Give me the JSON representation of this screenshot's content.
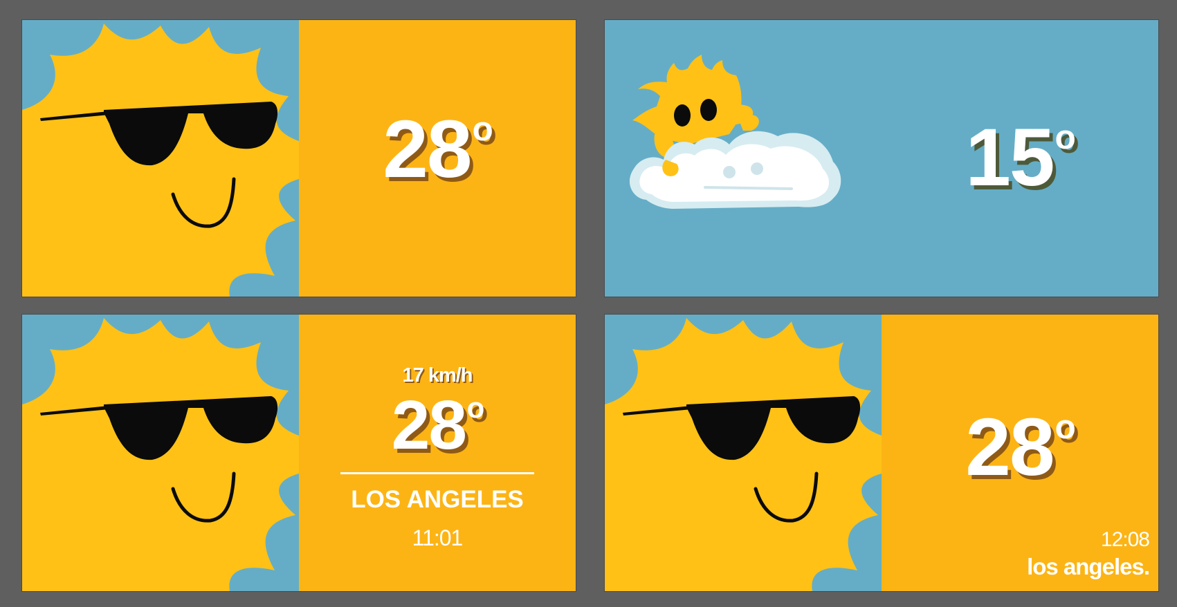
{
  "colors": {
    "background": "#5f5f5f",
    "sky_blue": "#65adc6",
    "sun_yellow": "#ffc116",
    "panel_orange": "#fcb415",
    "text_white": "#ffffff"
  },
  "tiles": [
    {
      "illustration": "cool-sun-with-sunglasses-icon",
      "temperature": "28",
      "degree": "o"
    },
    {
      "illustration": "sun-peeking-behind-cloud-icon",
      "temperature": "15",
      "degree": "o"
    },
    {
      "illustration": "cool-sun-with-sunglasses-icon",
      "wind": "17 km/h",
      "temperature": "28",
      "degree": "o",
      "city": "LOS ANGELES",
      "time": "11:01"
    },
    {
      "illustration": "cool-sun-with-sunglasses-icon",
      "temperature": "28",
      "degree": "o",
      "time": "12:08",
      "city": "los angeles."
    }
  ]
}
